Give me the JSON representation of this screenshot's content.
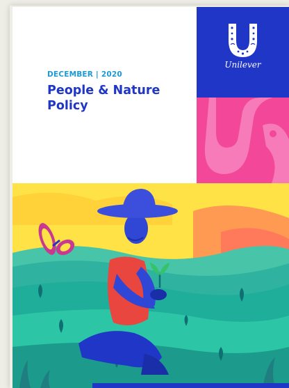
{
  "report": {
    "date": "DECEMBER | 2020",
    "title": "People & Nature Policy"
  },
  "brand": {
    "name": "Unilever"
  },
  "colors": {
    "brand_blue": "#1f36c7",
    "accent_cyan": "#1c9ad6",
    "pink": "#f3489a",
    "sky_yellow": "#ffe245",
    "field_green": "#1fae9a"
  },
  "icons": [
    "unilever-u-logo",
    "butterfly",
    "seedling",
    "wide-hat"
  ]
}
